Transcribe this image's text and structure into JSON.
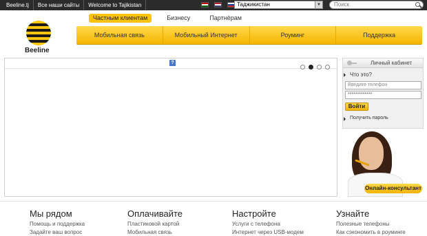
{
  "topbar": {
    "links": [
      "Beeline.tj",
      "Все наши сайты",
      "Welcome to Tajikistan"
    ],
    "country_select": "Таджикистан",
    "search_placeholder": "Поиск"
  },
  "logo": {
    "text": "Beeline"
  },
  "segments": [
    "Частным клиентам",
    "Бизнесу",
    "Партнёрам"
  ],
  "nav": [
    "Мобильная связь",
    "Мобильный Интернет",
    "Роуминг",
    "Поддержка"
  ],
  "banner": {
    "help_icon": "?"
  },
  "login": {
    "title": "Личный кабинет",
    "what_is_it": "Что это?",
    "phone_placeholder": "Введите телефон",
    "password_mask": "*************",
    "submit": "Войти",
    "get_password": "Получить пароль"
  },
  "consultant": {
    "button": "Онлайн-консультант"
  },
  "footer": {
    "columns": [
      {
        "title": "Мы рядом",
        "links": [
          "Помощь и поддержка",
          "Задайте ваш вопрос"
        ]
      },
      {
        "title": "Оплачивайте",
        "links": [
          "Пластиковой картой",
          "Мобильная связь"
        ]
      },
      {
        "title": "Настройте",
        "links": [
          "Услуги с телефона",
          "Интернет через USB-модем"
        ]
      },
      {
        "title": "Узнайте",
        "links": [
          "Полезные телефоны",
          "Как сэкономить в роуминге"
        ]
      }
    ]
  },
  "colors": {
    "brand_yellow": "#fdc30f",
    "topbar": "#2b2b2b"
  }
}
